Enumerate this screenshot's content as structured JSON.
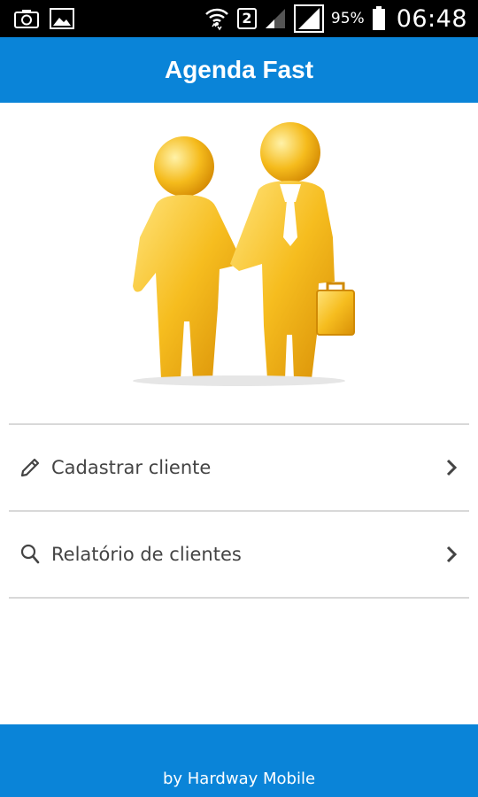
{
  "status_bar": {
    "sim_slot": "2",
    "battery_percent": "95%",
    "time": "06:48",
    "icons": [
      "camera-icon",
      "image-icon",
      "wifi-icon",
      "sim-icon",
      "signal-icon",
      "signal-icon",
      "battery-icon"
    ]
  },
  "app_bar": {
    "title": "Agenda Fast"
  },
  "hero": {
    "image": "business-handshake-illustration"
  },
  "menu": {
    "items": [
      {
        "label": "Cadastrar cliente",
        "icon": "pencil-icon"
      },
      {
        "label": "Relatório de clientes",
        "icon": "search-icon"
      }
    ]
  },
  "footer": {
    "text": "by Hardway Mobile"
  },
  "colors": {
    "primary": "#0a84d8",
    "text": "#444444",
    "divider": "#d8d8d8",
    "figure": "#f3b21a"
  }
}
